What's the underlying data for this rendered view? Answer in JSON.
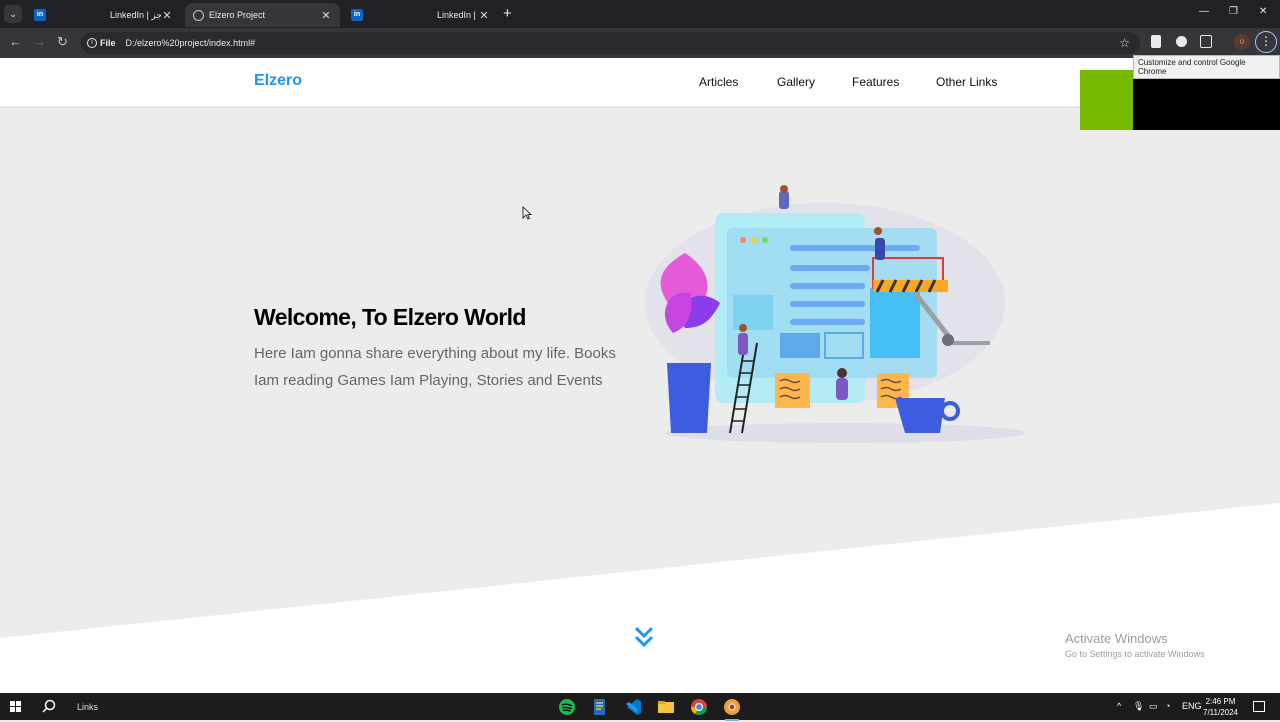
{
  "browser": {
    "tabs": [
      {
        "title": "LinkedIn | الموجز",
        "favicon": "linkedin-icon",
        "active": false
      },
      {
        "title": "Elzero Project",
        "favicon": "globe-icon",
        "active": true
      },
      {
        "title": "LinkedIn | نشر",
        "favicon": "linkedin-icon",
        "active": false
      }
    ],
    "new_tab": "+",
    "window_controls": {
      "minimize": "—",
      "restore": "❐",
      "close": "✕"
    },
    "nav": {
      "back": "←",
      "forward": "→",
      "reload": "↻"
    },
    "address": {
      "chip": "File",
      "url": "D:/elzero%20project/index.html#"
    },
    "tooltip": "Customize and control Google Chrome",
    "profile_initial": "o"
  },
  "site": {
    "logo": "Elzero",
    "nav": [
      "Articles",
      "Gallery",
      "Features",
      "Other Links"
    ],
    "hero": {
      "title": "Welcome, To Elzero World",
      "text": "Here Iam gonna share everything about my life. Books Iam reading Games Iam Playing, Stories and Events"
    }
  },
  "watermark": {
    "line1": "Activate Windows",
    "line2": "Go to Settings to activate Windows"
  },
  "taskbar": {
    "search_label": "Links",
    "apps": [
      "spotify-icon",
      "notepad-icon",
      "vscode-icon",
      "file-explorer-icon",
      "chrome-icon",
      "chrome-canary-icon"
    ],
    "language": "ENG",
    "time": "2:46 PM",
    "date": "7/11/2024"
  },
  "colors": {
    "brand": "#2196f3",
    "green": "#76b900",
    "hero_bg": "#ececec"
  }
}
